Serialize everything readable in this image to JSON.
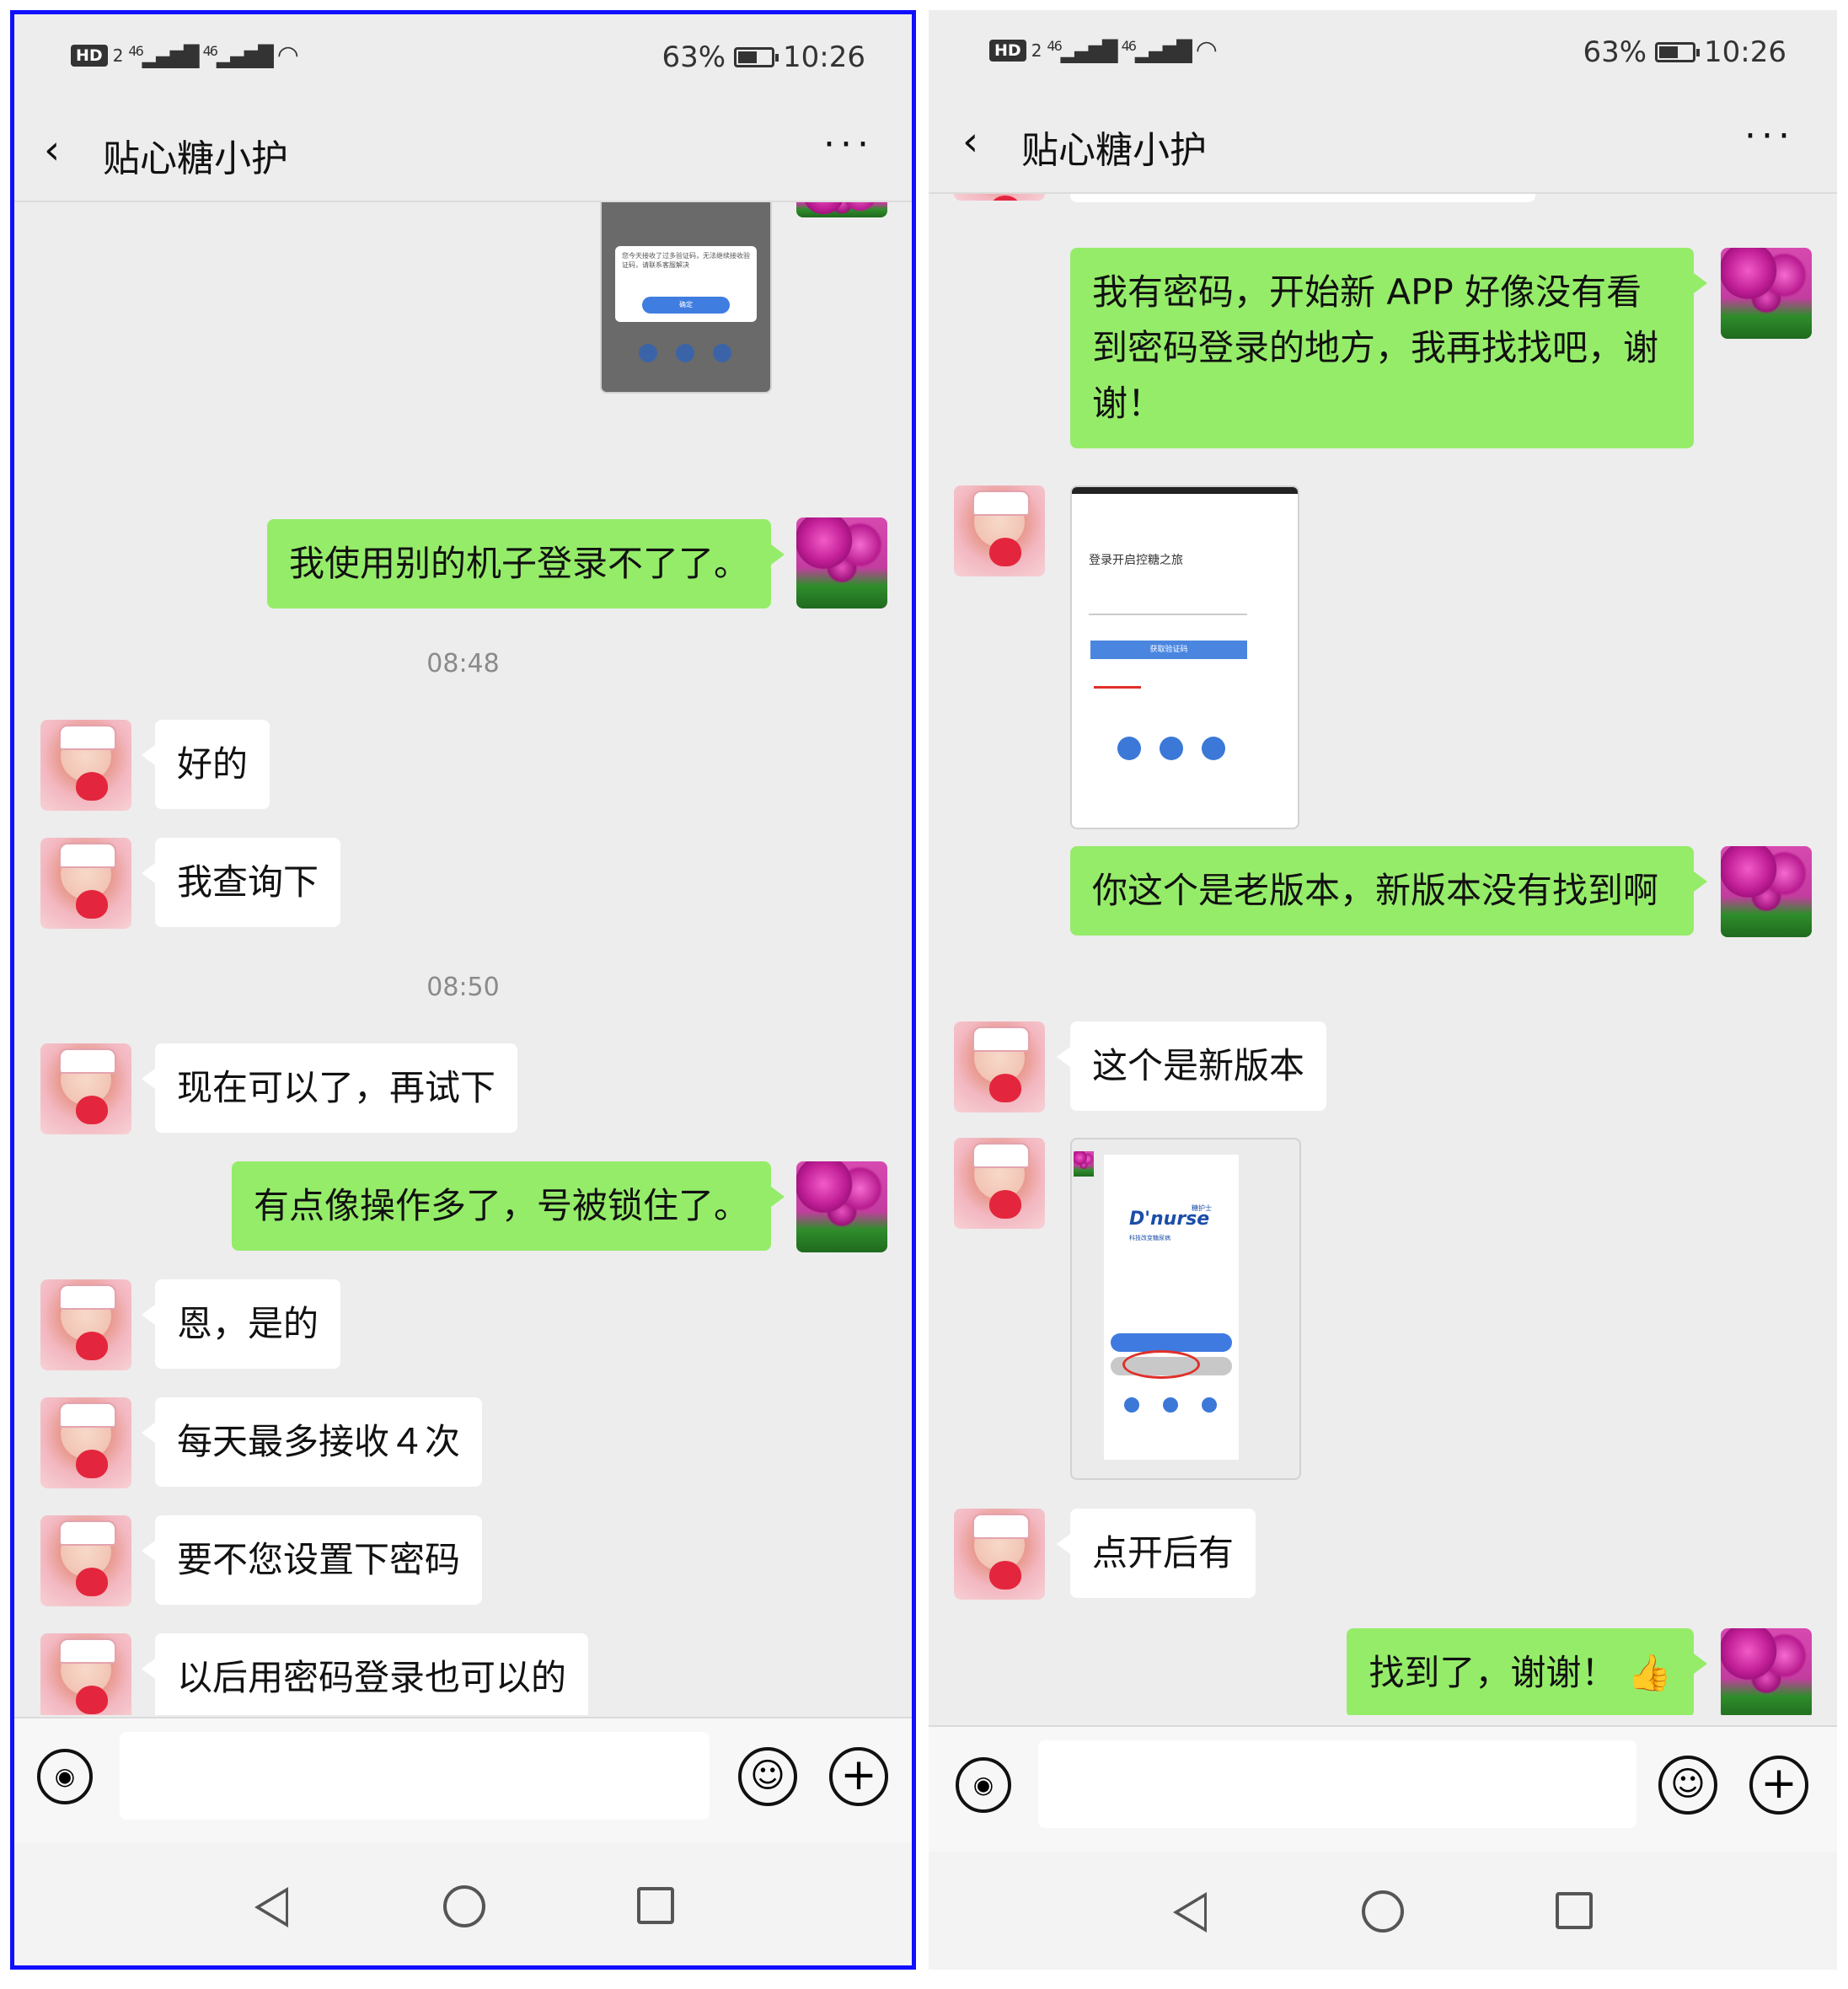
{
  "status": {
    "hd": "HD",
    "sim": "2",
    "net1": "46",
    "net2": "46",
    "battery": "63%",
    "battery_level": 0.63,
    "time": "10:26"
  },
  "chat_title": "贴心糖小护",
  "screen1": {
    "timestamps": [
      "08:48",
      "08:50"
    ],
    "messages": [
      "我使用别的机子登录不了了。",
      "好的",
      "我查询下",
      "现在可以了，再试下",
      "有点像操作多了，号被锁住了。",
      "恩，是的",
      "每天最多接收４次",
      "要不您设置下密码",
      "以后用密码登录也可以的"
    ],
    "image_texts": [
      "您今天接收了过多验证码，无法继续接收验证码，请联系客服解决",
      "确定"
    ]
  },
  "screen2": {
    "messages": [
      "我有密码，开始新 APP 好像没有看到密码登录的地方，我再找找吧，谢谢！",
      "你这个是老版本，新版本没有找到啊",
      "这个是新版本",
      "点开后有",
      "找到了，谢谢！"
    ],
    "image1": {
      "title": "登录开启控糖之旅",
      "button": "获取验证码"
    },
    "image2": {
      "logo": "D'nurse",
      "logo_sub": "糖护士",
      "logo_tag": "科技改变糖尿病"
    },
    "thumbs_up": "👍"
  },
  "icons": {
    "voice": "voice-icon",
    "emoji": "emoji-icon",
    "plus": "plus-icon",
    "more": "more-icon",
    "back": "back-icon"
  }
}
